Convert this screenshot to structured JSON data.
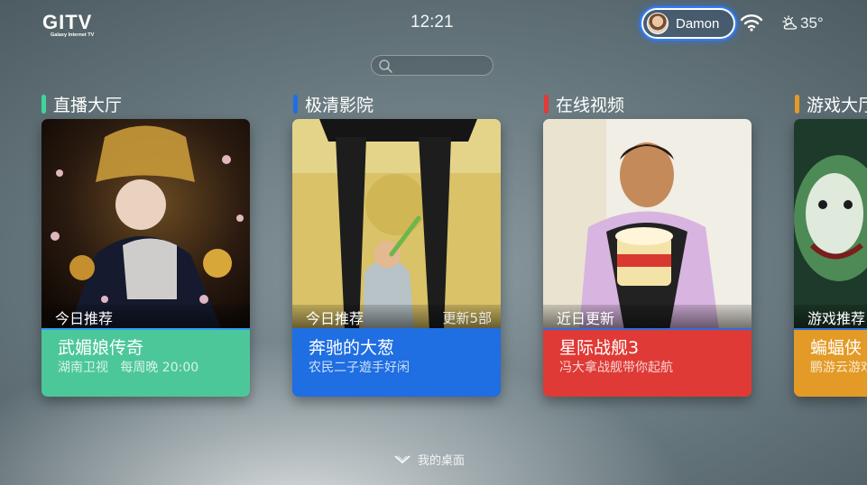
{
  "header": {
    "logo_text": "GITV",
    "logo_subtitle": "Galaxy Internet TV",
    "time": "12:21",
    "user_name": "Damon",
    "temperature": "35°",
    "wifi_icon": "wifi-icon",
    "weather_icon": "partly-cloudy-icon",
    "search_icon": "search-icon"
  },
  "sections": [
    {
      "title": "直播大厅",
      "color": "#3fd59a",
      "card": {
        "tag": "今日推荐",
        "tag_right": "",
        "title": "武媚娘传奇",
        "subtitle": "湖南卫视   每周晚 20:00",
        "color": "#4cc79a"
      }
    },
    {
      "title": "极清影院",
      "color": "#1e6fe6",
      "card": {
        "tag": "今日推荐",
        "tag_right": "更新5部",
        "title": "奔驰的大葱",
        "subtitle": "农民二子遊手好闲",
        "color": "#1f6ee2"
      }
    },
    {
      "title": "在线视频",
      "color": "#e23a36",
      "card": {
        "tag": "近日更新",
        "tag_right": "",
        "title": "星际战舰3",
        "subtitle": "冯大拿战舰带你起航",
        "color": "#df3a35"
      }
    },
    {
      "title": "游戏大厅",
      "color": "#e39a26",
      "card": {
        "tag": "游戏推荐",
        "tag_right": "",
        "title": "蝙蝠侠",
        "subtitle": "鹏游云游戏",
        "color": "#e39a26"
      }
    }
  ],
  "footer": {
    "hint": "我的桌面",
    "icon": "chevron-down-icon"
  }
}
